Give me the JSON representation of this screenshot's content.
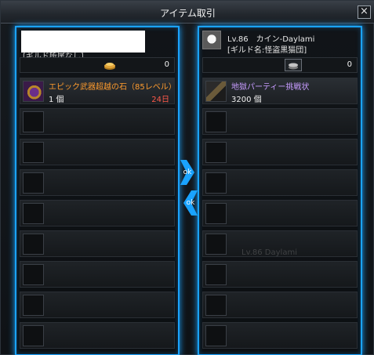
{
  "window": {
    "title": "アイテム取引",
    "close_label": "×"
  },
  "left": {
    "name_redacted": true,
    "subline": "[ギルド所属なし]",
    "money": "0",
    "slots": [
      {
        "name": "エピック武器超越の石（85レベル）",
        "qty": "1 個",
        "days": "24日",
        "name_color": "#ff9c2e",
        "icon": "epic-stone-icon"
      },
      null,
      null,
      null,
      null,
      null,
      null,
      null,
      null
    ]
  },
  "right": {
    "level_name": "Lv.86　カイン-Daylami",
    "guild": "[ギルド名:怪盗黒猫団]",
    "money": "0",
    "slots": [
      {
        "name": "地獄パーティー挑戦状",
        "qty": "3200 個",
        "days": "",
        "name_color": "#c79cff",
        "icon": "challenge-letter-icon"
      },
      null,
      null,
      null,
      null,
      null,
      null,
      null,
      null
    ],
    "faint_texts": [
      "Lv.86 Daylami"
    ]
  },
  "ok": {
    "left": "ok",
    "right": "ok"
  },
  "colors": {
    "accent": "#1aa3ff",
    "epic": "#ff9c2e",
    "unique": "#c79cff",
    "days": "#ff5a4a"
  }
}
